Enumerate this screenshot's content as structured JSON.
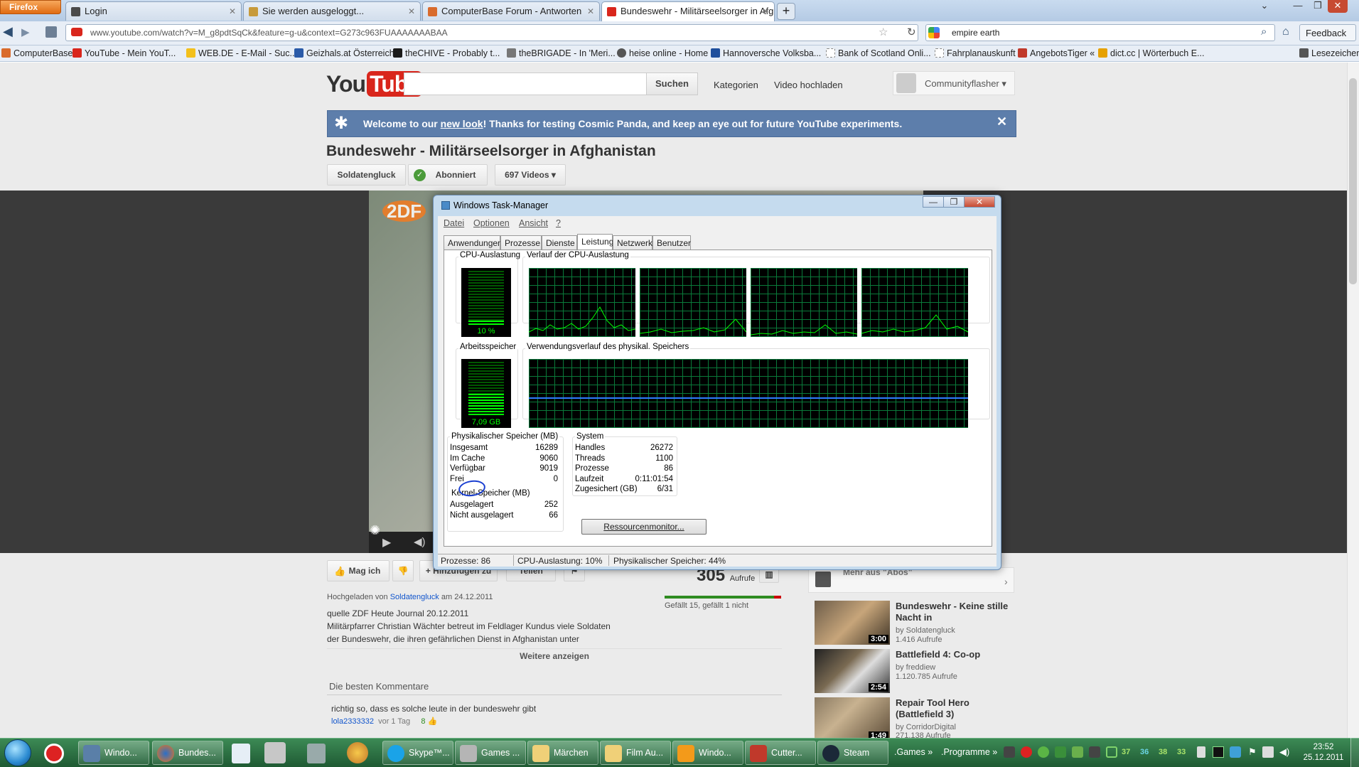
{
  "browser": {
    "menu_button": "Firefox",
    "tabs": [
      {
        "label": "Login"
      },
      {
        "label": "Sie werden ausgeloggt..."
      },
      {
        "label": "ComputerBase Forum - Antworten"
      },
      {
        "label": "Bundeswehr - Militärseelsorger in Afg..."
      }
    ],
    "new_tab": "+",
    "url": "www.youtube.com/watch?v=M_g8pdtSqCk&feature=g-u&context=G273c963FUAAAAAAABAA",
    "search_value": "empire earth",
    "feedback": "Feedback",
    "bookmarks_menu": "Lesezeichen",
    "bookmarks": [
      "ComputerBase",
      "YouTube - Mein YouT...",
      "WEB.DE - E-Mail - Suc...",
      "Geizhals.at Österreich",
      "theCHIVE - Probably t...",
      "theBRIGADE - In 'Meri...",
      "heise online - Home",
      "Hannoversche Volksba...",
      "Bank of Scotland Onli...",
      "Fahrplanauskunft",
      "AngebotsTiger «",
      "dict.cc | Wörterbuch E..."
    ]
  },
  "youtube": {
    "logo_you": "You",
    "logo_tube": "Tube",
    "search_button": "Suchen",
    "nav_categories": "Kategorien",
    "nav_upload": "Video hochladen",
    "user": "Communityflasher",
    "banner_pre": "Welcome to our ",
    "banner_link": "new look",
    "banner_post": "! Thanks for testing Cosmic Panda, and keep an eye out for future YouTube experiments.",
    "video_title": "Bundeswehr - Militärseelsorger in Afghanistan",
    "channel": "Soldatengluck",
    "subscribed": "Abonniert",
    "videos_count": "697 Videos",
    "like_button": "Mag ich",
    "add_to": "+ Hinzufügen zu",
    "share": "Teilen",
    "views_number": "305",
    "views_label": "Aufrufe",
    "likes_text": "Gefällt 15, gefällt 1 nicht",
    "like_ratio": 0.94,
    "uploaded_prefix": "Hochgeladen von",
    "uploaded_user": "Soldatengluck",
    "uploaded_date": "am 24.12.2011",
    "desc_line1": "quelle ZDF Heute Journal 20.12.2011",
    "desc_line2": "Militärpfarrer Christian Wächter betreut im Feldlager Kundus viele Soldaten",
    "desc_line3": "der Bundeswehr, die ihren gefährlichen Dienst in Afghanistan unter",
    "more_info": "Weitere anzeigen",
    "best_comments": "Die besten Kommentare",
    "comment_text": "richtig so, dass es solche leute in der bundeswehr gibt",
    "comment_user": "lola2333332",
    "comment_time": "vor 1 Tag",
    "comment_likes": "8",
    "zdf_logo": "2DF",
    "sidebar_heading": "Mehr aus \"Abos\"",
    "related": [
      {
        "title": "Bundeswehr - Keine stille Nacht in",
        "by": "by Soldatengluck",
        "views": "1.416 Aufrufe",
        "duration": "3:00"
      },
      {
        "title": "Battlefield 4: Co-op",
        "by": "by freddiew",
        "views": "1.120.785 Aufrufe",
        "duration": "2:54"
      },
      {
        "title": "Repair Tool Hero (Battlefield 3)",
        "by": "by CorridorDigital",
        "views": "271.138 Aufrufe",
        "duration": "1:49"
      }
    ]
  },
  "taskmanager": {
    "title": "Windows Task-Manager",
    "menu": [
      "Datei",
      "Optionen",
      "Ansicht",
      "?"
    ],
    "tabs": [
      "Anwendungen",
      "Prozesse",
      "Dienste",
      "Leistung",
      "Netzwerk",
      "Benutzer"
    ],
    "active_tab": "Leistung",
    "cpu_label": "CPU-Auslastung",
    "cpu_value": "10 %",
    "cpu_level": 0.1,
    "cpu_history_label": "Verlauf der CPU-Auslastung",
    "mem_label": "Arbeitsspeicher",
    "mem_value": "7,09 GB",
    "mem_level": 0.44,
    "mem_history_label": "Verwendungsverlauf des physikal. Speichers",
    "phys_heading": "Physikalischer Speicher (MB)",
    "phys": [
      {
        "k": "Insgesamt",
        "v": "16289"
      },
      {
        "k": "Im Cache",
        "v": "9060"
      },
      {
        "k": "Verfügbar",
        "v": "9019"
      },
      {
        "k": "Frei",
        "v": "0"
      }
    ],
    "kernel_heading": "Kernel-Speicher (MB)",
    "kernel": [
      {
        "k": "Ausgelagert",
        "v": "252"
      },
      {
        "k": "Nicht ausgelagert",
        "v": "66"
      }
    ],
    "system_heading": "System",
    "system": [
      {
        "k": "Handles",
        "v": "26272"
      },
      {
        "k": "Threads",
        "v": "1100"
      },
      {
        "k": "Prozesse",
        "v": "86"
      },
      {
        "k": "Laufzeit",
        "v": "0:11:01:54"
      },
      {
        "k": "Zugesichert (GB)",
        "v": "6/31"
      }
    ],
    "resource_button": "Ressourcenmonitor...",
    "status_processes": "Prozesse: 86",
    "status_cpu": "CPU-Auslastung: 10%",
    "status_mem": "Physikalischer Speicher: 44%"
  },
  "taskbar": {
    "buttons": [
      "Windo...",
      "Bundes...",
      "Skype™...",
      "Games ...",
      "Märchen",
      "Film Au...",
      "Windo...",
      "Cutter...",
      "Steam"
    ],
    "toolbars": [
      ".Games",
      ".Programme"
    ],
    "tray_numbers": [
      "37",
      "36",
      "38",
      "33"
    ],
    "time": "23:52",
    "date": "25.12.2011"
  }
}
